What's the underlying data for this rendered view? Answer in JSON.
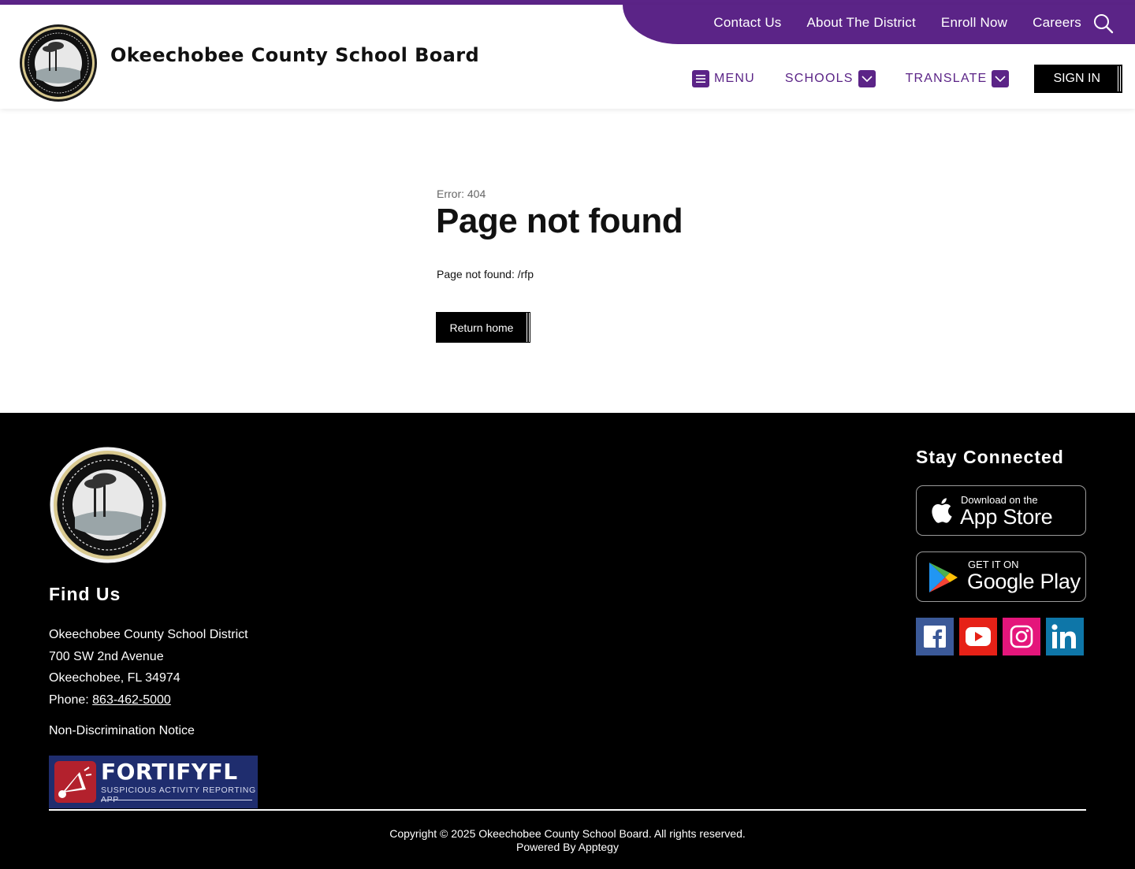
{
  "header": {
    "site_title": "Okeechobee County School Board",
    "util_links": [
      "Contact Us",
      "About The District",
      "Enroll Now",
      "Careers"
    ],
    "nav": {
      "menu": "MENU",
      "schools": "SCHOOLS",
      "translate": "TRANSLATE",
      "sign_in": "SIGN IN"
    }
  },
  "main": {
    "error_code": "Error: 404",
    "title": "Page not found",
    "message": "Page not found: /rfp",
    "return_label": "Return home"
  },
  "footer": {
    "find_us": "Find Us",
    "district": "Okeechobee County School District",
    "street": "700 SW 2nd Avenue",
    "city": "Okeechobee, FL 34974",
    "phone_label": "Phone: ",
    "phone": "863-462-5000",
    "nondiscrimination": "Non-Discrimination Notice",
    "fortify": {
      "name": "FORTIFYFL",
      "tagline": "SUSPICIOUS ACTIVITY REPORTING APP"
    },
    "stay_connected": "Stay Connected",
    "app_store": {
      "small": "Download on the",
      "big": "App Store"
    },
    "google_play": {
      "small": "GET IT ON",
      "big": "Google Play"
    },
    "copyright": "Copyright © 2025 Okeechobee County School Board. All rights reserved.",
    "powered_by": "Powered By Apptegy"
  },
  "colors": {
    "brand": "#5b2487",
    "facebook": "#3b5998",
    "youtube": "#e62117",
    "instagram": "#e4167b",
    "linkedin": "#0e76a8"
  },
  "icons": [
    "search-icon",
    "menu-icon",
    "chevron-down-icon",
    "apple-icon",
    "google-play-icon",
    "facebook-icon",
    "youtube-icon",
    "instagram-icon",
    "linkedin-icon"
  ]
}
